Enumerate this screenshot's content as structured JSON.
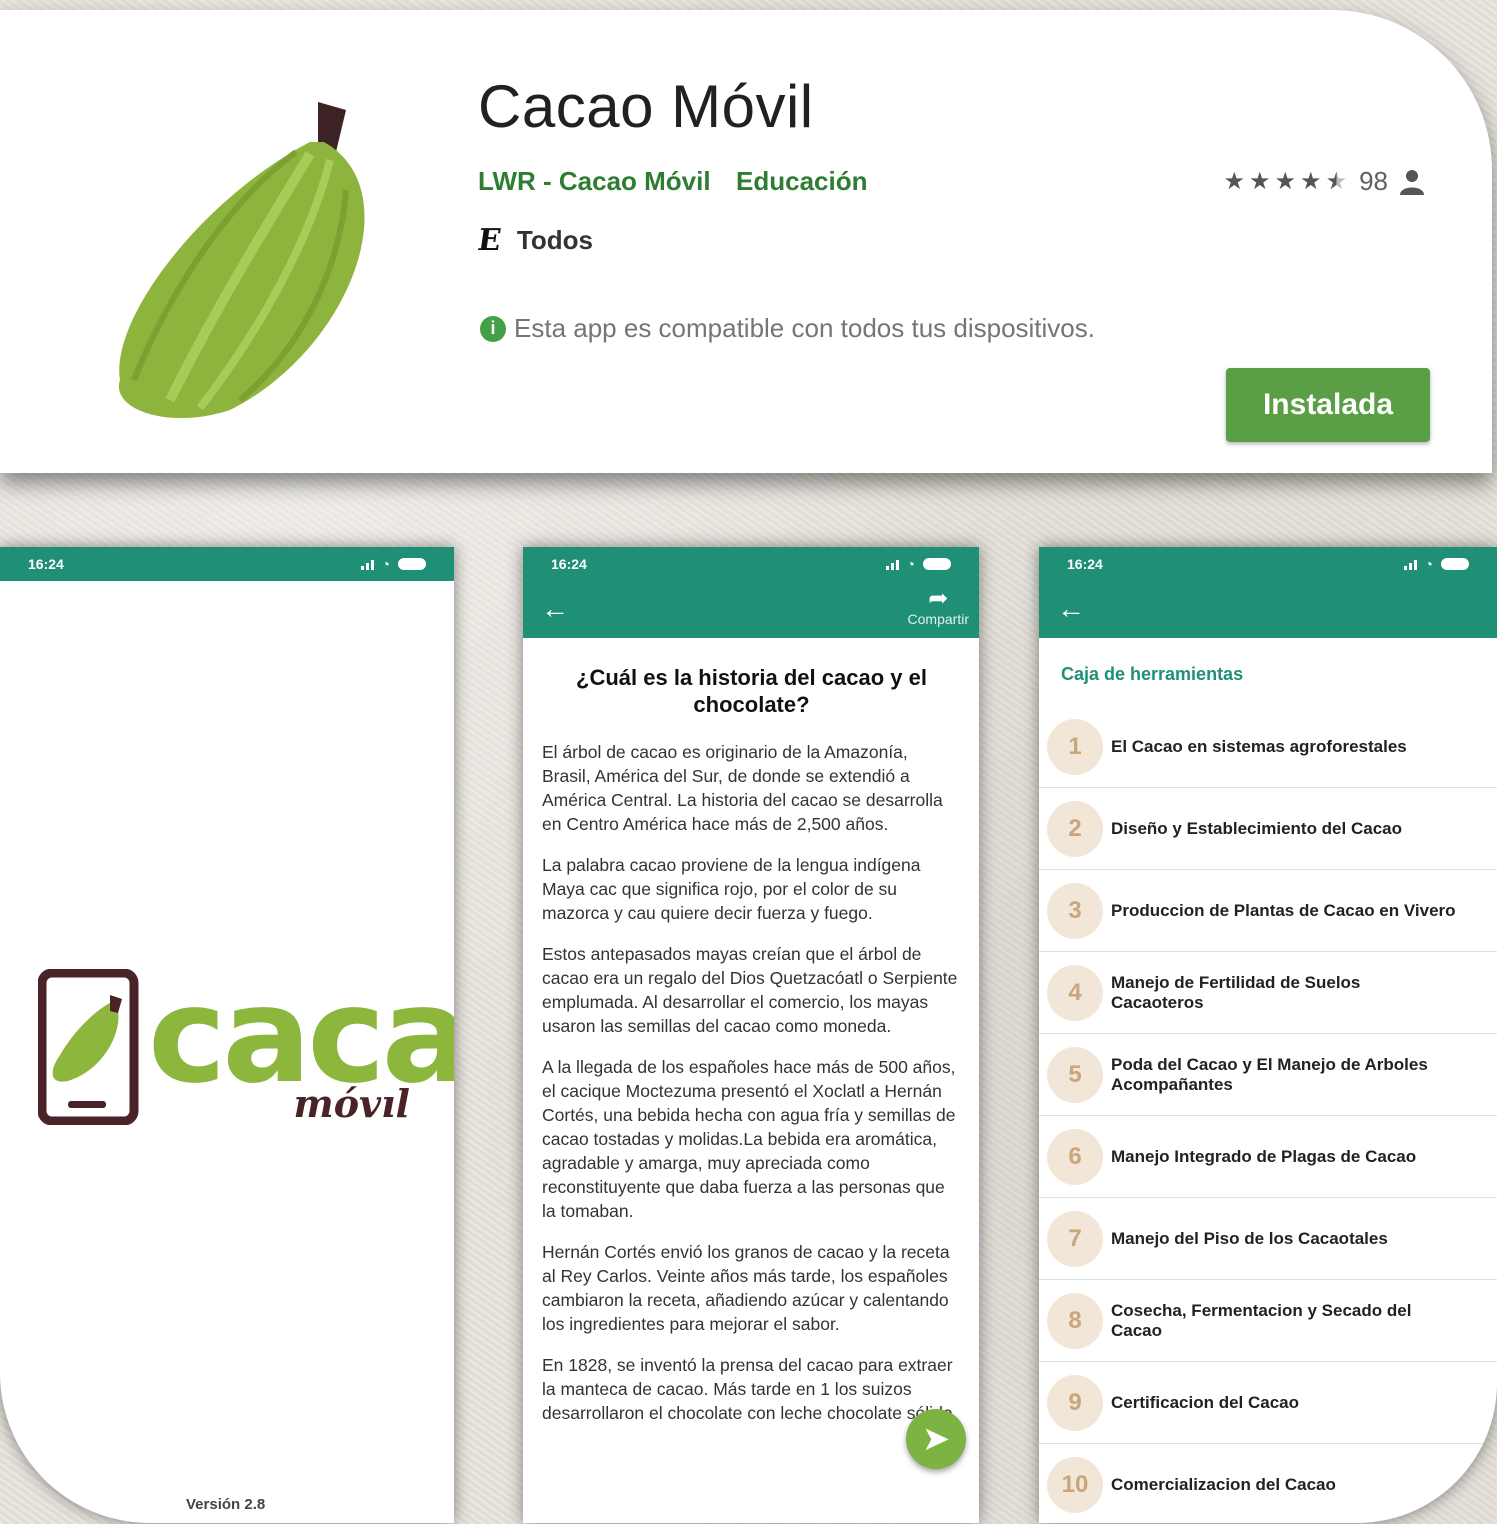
{
  "store": {
    "title": "Cacao Móvil",
    "developer": "LWR - Cacao Móvil",
    "category": "Educación",
    "rating_count": "98",
    "rating_stars": 4.5,
    "content_rating_icon": "E",
    "content_rating": "Todos",
    "compatibility": "Esta app es compatible con todos tus dispositivos.",
    "install_label": "Instalada",
    "accent_color": "#5a9e45"
  },
  "status_bar": {
    "time": "16:24"
  },
  "splash": {
    "logo_word": "cacao",
    "logo_sub": "móvıl",
    "version": "Versión 2.8"
  },
  "article": {
    "share_label": "Compartir",
    "title": "¿Cuál es la historia del cacao y el chocolate?",
    "paragraphs": [
      "El árbol de cacao es originario de la Amazonía, Brasil, América del Sur, de donde se extendió a América Central. La historia del cacao se desarrolla en Centro América hace más de 2,500 años.",
      "La palabra cacao proviene de la lengua indígena Maya cac que significa rojo, por el color de su mazorca y cau quiere decir fuerza y fuego.",
      "Estos antepasados mayas creían que el árbol de cacao era un regalo del Dios Quetzacóatl o Serpiente emplumada. Al desarrollar el comercio, los mayas usaron las semillas del cacao como moneda.",
      "A la llegada de los españoles hace más de 500 años, el cacique Moctezuma presentó el Xoclatl a Hernán Cortés, una bebida hecha con agua fría y semillas de cacao tostadas y molidas.La bebida era aromática, agradable y amarga, muy apreciada como reconstituyente que daba fuerza a las personas que la tomaban.",
      "Hernán Cortés envió los granos de cacao y la receta al Rey Carlos. Veinte años más tarde, los españoles cambiaron la receta, añadiendo azúcar y calentando los ingredientes para mejorar el sabor.",
      "En 1828, se inventó la prensa del cacao para extraer la manteca de cacao. Más tarde en 1 los suizos desarrollaron el chocolate con leche chocolate sólido."
    ]
  },
  "toolbox": {
    "title": "Caja de herramientas",
    "items": [
      {
        "num": "1",
        "label": "El Cacao en sistemas agroforestales"
      },
      {
        "num": "2",
        "label": "Diseño y Establecimiento del Cacao"
      },
      {
        "num": "3",
        "label": "Produccion de Plantas de Cacao en Vivero"
      },
      {
        "num": "4",
        "label": "Manejo de Fertilidad de Suelos Cacaoteros"
      },
      {
        "num": "5",
        "label": "Poda del Cacao y El Manejo de Arboles Acompañantes"
      },
      {
        "num": "6",
        "label": "Manejo Integrado de Plagas de Cacao"
      },
      {
        "num": "7",
        "label": "Manejo del Piso de los Cacaotales"
      },
      {
        "num": "8",
        "label": "Cosecha, Fermentacion y Secado del Cacao"
      },
      {
        "num": "9",
        "label": "Certificacion del Cacao"
      },
      {
        "num": "10",
        "label": "Comercializacion del Cacao"
      }
    ]
  },
  "colors": {
    "teal": "#1f8f76",
    "green": "#8cb63c",
    "brown": "#4a2328"
  }
}
